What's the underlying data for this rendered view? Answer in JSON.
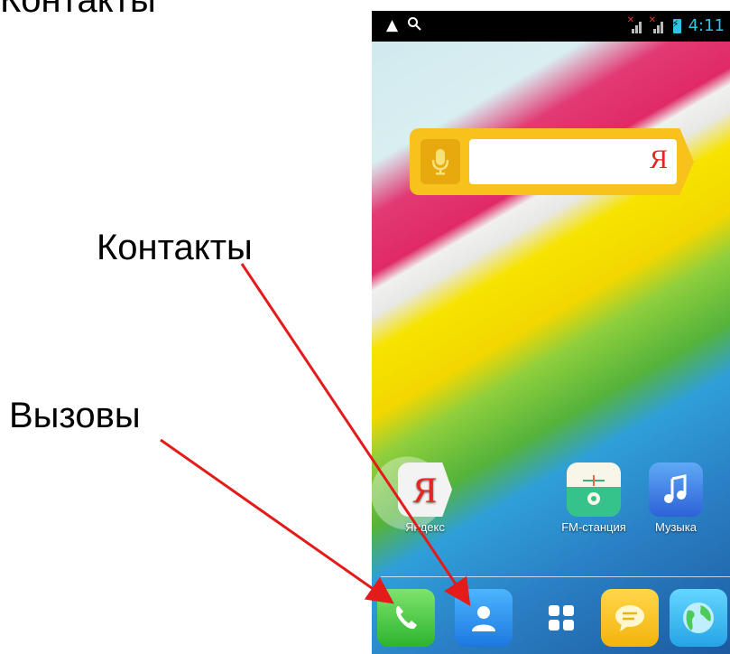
{
  "slide": {
    "title_partial": "Контакты",
    "callout_contacts": "Контакты",
    "callout_calls": "Вызовы"
  },
  "statusbar": {
    "time": "4:11"
  },
  "search_widget": {
    "logo_letter": "Я"
  },
  "home_apps": [
    {
      "label": "Яндекс",
      "icon": "yandex-icon"
    },
    {
      "label": "FM-станция",
      "icon": "fm-radio-icon"
    },
    {
      "label": "Музыка",
      "icon": "music-icon"
    }
  ],
  "dock": [
    {
      "icon": "phone-icon"
    },
    {
      "icon": "contacts-icon"
    },
    {
      "icon": "app-drawer-icon"
    },
    {
      "icon": "messages-icon"
    },
    {
      "icon": "browser-icon"
    }
  ],
  "colors": {
    "arrow": "#e31b1b",
    "statusbar_accent": "#2ec4e8",
    "search_widget": "#f7c21b"
  }
}
